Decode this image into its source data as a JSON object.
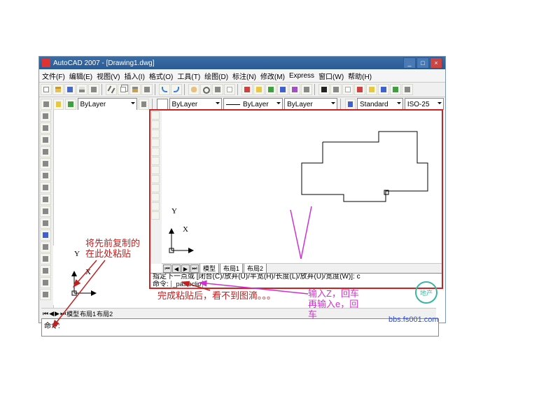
{
  "titlebar": {
    "title": "AutoCAD 2007 - [Drawing1.dwg]"
  },
  "menu": {
    "file": "文件(F)",
    "edit": "编辑(E)",
    "view": "视图(V)",
    "insert": "插入(I)",
    "format": "格式(O)",
    "tools": "工具(T)",
    "draw": "绘图(D)",
    "dimension": "标注(N)",
    "modify": "修改(M)",
    "express": "Express",
    "window": "窗口(W)",
    "help": "帮助(H)"
  },
  "props": {
    "layer": "ByLayer",
    "linetype": "ByLayer",
    "lineweight": "ByLayer",
    "style": "Standard",
    "scale": "ISO-25"
  },
  "axes": {
    "x": "X",
    "y": "Y"
  },
  "tabs": {
    "model": "模型",
    "layout1": "布局1",
    "layout2": "布局2"
  },
  "command": {
    "line1": "指定下一点或 [闭合(C)/放弃(U)/半宽(H)/长度(L)/放弃(U)/宽度(W)]: c",
    "prompt": "命令:",
    "hint": "_pasteclip"
  },
  "annotations": {
    "left": "将先前复制的\n在此处粘贴",
    "bottom": "完成粘贴后，看不到图滴。。。",
    "right": "输入Z，回车\n再输入e，回\n车"
  },
  "watermark": {
    "text": "地产",
    "url": "bbs.fs001.com"
  }
}
